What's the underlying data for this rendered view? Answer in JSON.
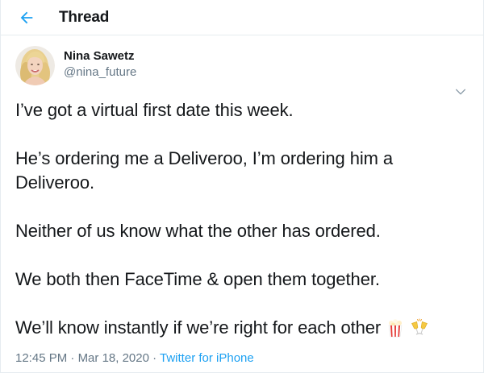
{
  "header": {
    "title": "Thread",
    "back_icon": "arrow-left-icon",
    "accent": "#1da1f2"
  },
  "tweet": {
    "author": {
      "name": "Nina Sawetz",
      "handle": "@nina_future",
      "avatar": "avatar"
    },
    "menu_icon": "chevron-down-icon",
    "paragraphs": [
      "I’ve got a virtual first date this week.",
      "He’s ordering me a Deliveroo, I’m ordering him a Deliveroo.",
      "Neither of us know what the other has ordered.",
      "We both then FaceTime & open them together.",
      "We’ll know instantly if we’re right for each other"
    ],
    "emojis": [
      "popcorn-icon",
      "clinking-glasses-icon"
    ],
    "meta": {
      "time": "12:45 PM",
      "separator1": " · ",
      "date": "Mar 18, 2020",
      "separator2": " · ",
      "source": "Twitter for iPhone"
    }
  },
  "colors": {
    "text": "#14171a",
    "muted": "#657786",
    "link": "#1da1f2",
    "border": "#e6ecf0"
  }
}
